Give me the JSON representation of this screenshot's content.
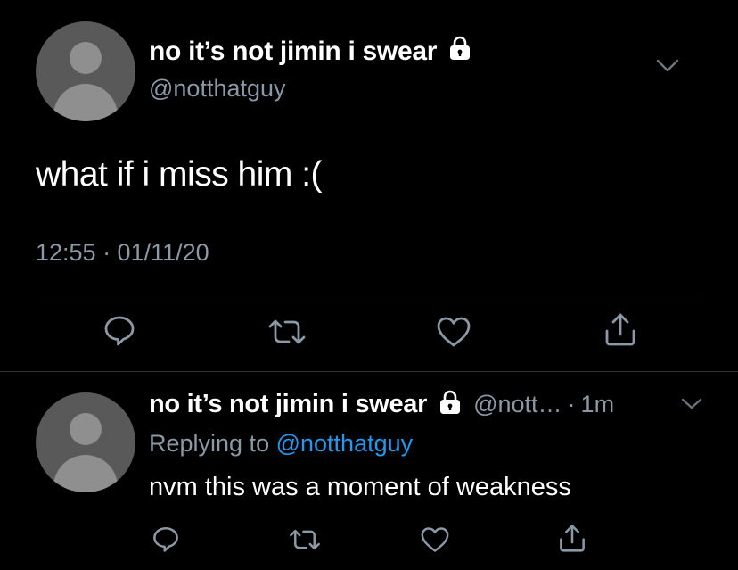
{
  "main_tweet": {
    "display_name": "no it’s not jimin i swear",
    "handle": "@notthatguy",
    "text": "what if i miss him :(",
    "timestamp": "12:55 · 01/11/20",
    "icons": {
      "lock": "lock-icon",
      "menu": "chevron-down-icon",
      "reply": "reply-icon",
      "retweet": "retweet-icon",
      "like": "heart-icon",
      "share": "share-icon"
    }
  },
  "reply_tweet": {
    "display_name": "no it’s not jimin i swear",
    "handle": "@nott…",
    "separator": "·",
    "age": "1m",
    "replying_prefix": "Replying to",
    "replying_to": "@notthatguy",
    "text": "nvm this was a moment of weakness"
  },
  "colors": {
    "background": "#000000",
    "primary_text": "#ffffff",
    "secondary_text": "#8b98a5",
    "mention": "#1d9bf0",
    "divider": "#2f3336",
    "avatar_bg": "#595959",
    "avatar_fg": "#8f8f8f"
  }
}
